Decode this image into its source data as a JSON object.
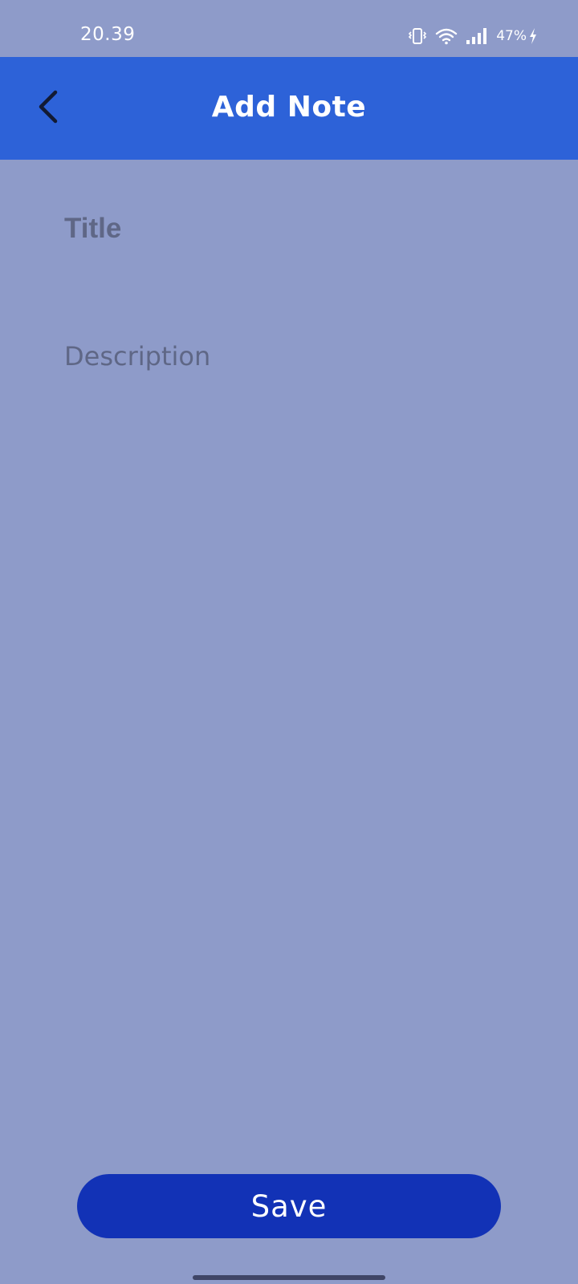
{
  "status_bar": {
    "time": "20.39",
    "battery": "47%",
    "icons": [
      "vibrate-icon",
      "wifi-icon",
      "signal-icon",
      "battery-charging-icon"
    ]
  },
  "app_bar": {
    "title": "Add Note",
    "back_icon": "chevron-left-icon",
    "background_color": "#2d62d8"
  },
  "form": {
    "title_placeholder": "Title",
    "title_value": "",
    "description_placeholder": "Description",
    "description_value": ""
  },
  "actions": {
    "save_label": "Save",
    "save_color": "#1232b6"
  },
  "colors": {
    "background": "#8e9bc9",
    "placeholder": "#5f6786"
  }
}
